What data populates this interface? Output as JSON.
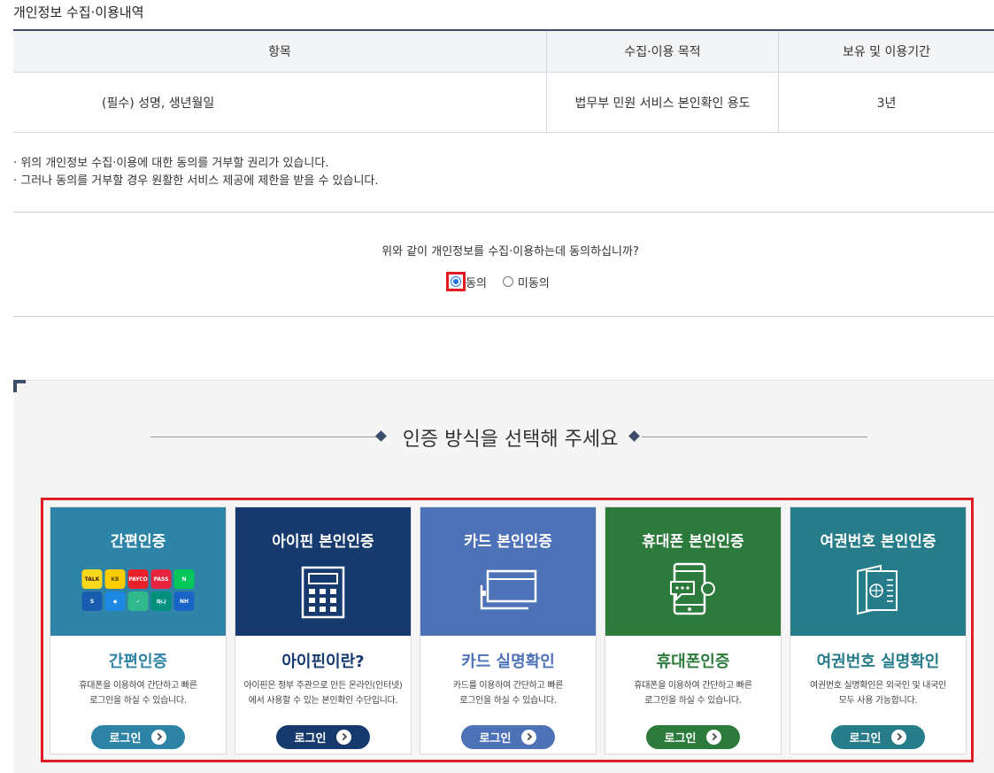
{
  "section_title": "개인정보 수집·이용내역",
  "table": {
    "headers": [
      "항목",
      "수집·이용 목적",
      "보유 및 이용기간"
    ],
    "rows": [
      [
        "(필수) 성명, 생년월일",
        "법무부 민원 서비스 본인확인 용도",
        "3년"
      ]
    ]
  },
  "notes": [
    "· 위의 개인정보 수집·이용에 대한 동의를 거부할 권리가 있습니다.",
    "· 그러나 동의를 거부할 경우 원활한 서비스 제공에 제한을 받을 수 있습니다."
  ],
  "consent": {
    "question": "위와 같이 개인정보를 수집·이용하는데 동의하십니까?",
    "agree": "동의",
    "disagree": "미동의",
    "selected": "동의"
  },
  "auth": {
    "title": "인증 방식을 선택해 주세요",
    "cards": [
      {
        "header": "간편인증",
        "title": "간편인증",
        "desc1": "휴대폰을 이용하여 간단하고 빠른",
        "desc2": "로그인을 하실 수 있습니다.",
        "button": "로그인",
        "color": "#2d84a6",
        "icon": "simple-auth-apps-icon"
      },
      {
        "header": "아이핀 본인인증",
        "title": "아이핀이란?",
        "desc1": "아이핀은 정부 주관으로 만든 온라인(인터넷)",
        "desc2": "에서 사용할 수 있는 본인확인 수단입니다.",
        "button": "로그인",
        "color": "#173a6e",
        "icon": "calculator-icon"
      },
      {
        "header": "카드 본인인증",
        "title": "카드 실명확인",
        "desc1": "카드를 이용하여 간단하고 빠른",
        "desc2": "로그인을 하실 수 있습니다.",
        "button": "로그인",
        "color": "#4e72b8",
        "icon": "card-icon"
      },
      {
        "header": "휴대폰 본인인증",
        "title": "휴대폰인증",
        "desc1": "휴대폰을 이용하여 간단하고 빠른",
        "desc2": "로그인을 하실 수 있습니다.",
        "button": "로그인",
        "color": "#2c7b3c",
        "icon": "mobile-phone-icon"
      },
      {
        "header": "여권번호 본인인증",
        "title": "여권번호 실명확인",
        "desc1": "여권번호 실명확인은 외국인 및 내국인",
        "desc2": "모두 사용 가능합니다.",
        "button": "로그인",
        "color": "#267c88",
        "icon": "passport-icon"
      }
    ],
    "apps": [
      {
        "label": "TALK",
        "color": "#f9d71c",
        "text": "#3a1d1d"
      },
      {
        "label": "KB",
        "color": "#ffcc00",
        "text": "#5a4a00"
      },
      {
        "label": "PAYCO",
        "color": "#e8202a",
        "text": "#ffffff"
      },
      {
        "label": "PASS",
        "color": "#e8253f",
        "text": "#ffffff"
      },
      {
        "label": "N",
        "color": "#03c75a",
        "text": "#ffffff"
      },
      {
        "label": "S",
        "color": "#1a5cb0",
        "text": "#ffffff"
      },
      {
        "label": "◆",
        "color": "#1e88e5",
        "text": "#ffffff"
      },
      {
        "label": "✓",
        "color": "#2fb98c",
        "text": "#ffffff"
      },
      {
        "label": "하나",
        "color": "#00907d",
        "text": "#ffffff"
      },
      {
        "label": "NH",
        "color": "#1a64c8",
        "text": "#ffffff"
      }
    ]
  }
}
